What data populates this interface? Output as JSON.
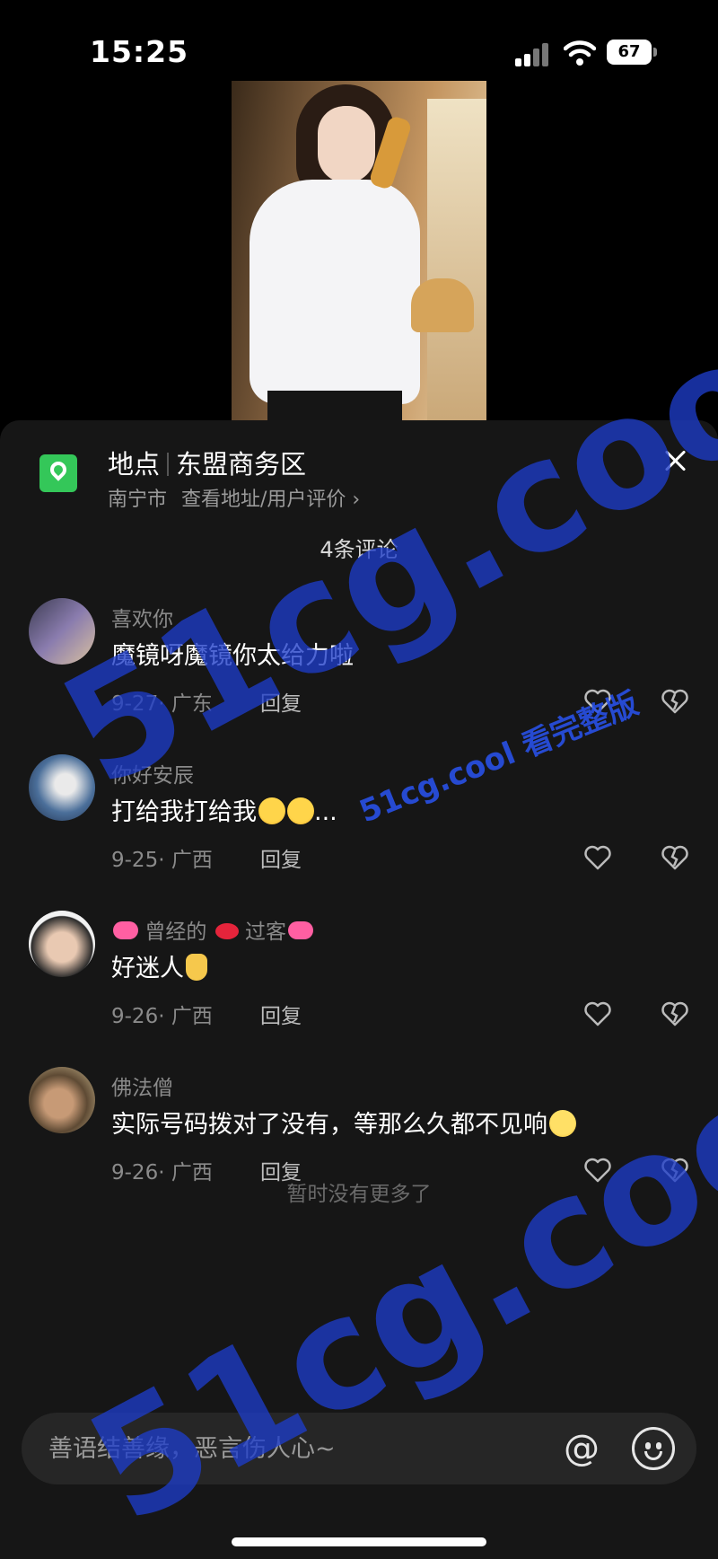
{
  "status_bar": {
    "time": "15:25",
    "battery": "67"
  },
  "location": {
    "label": "地点",
    "name": "东盟商务区",
    "city": "南宁市",
    "link": "查看地址/用户评价 ›"
  },
  "comment_count": "4条评论",
  "comments": [
    {
      "name": "喜欢你",
      "text": "魔镜呀魔镜你太给力啦",
      "meta": "9-27· 广东",
      "reply": "回复"
    },
    {
      "name": "你好安辰",
      "text": "打给我打给我",
      "text_suffix": "...",
      "meta": "9-25· 广西",
      "reply": "回复"
    },
    {
      "name": "曾经的",
      "name_mid": "过客",
      "text": "好迷人",
      "meta": "9-26· 广西",
      "reply": "回复"
    },
    {
      "name": "佛法僧",
      "text": "实际号码拨对了没有，等那么久都不见响",
      "meta": "9-26· 广西",
      "reply": "回复"
    }
  ],
  "no_more": "暂时没有更多了",
  "input": {
    "placeholder": "善语结善缘，恶言伤人心~"
  },
  "watermark": {
    "big": "51cg.cool",
    "small": "51cg.cool 看完整版"
  },
  "icons": [
    "signal-icon",
    "wifi-icon",
    "battery-icon",
    "location-pin-icon",
    "close-icon",
    "heart-icon",
    "broken-heart-icon",
    "at-icon",
    "emoji-icon"
  ]
}
